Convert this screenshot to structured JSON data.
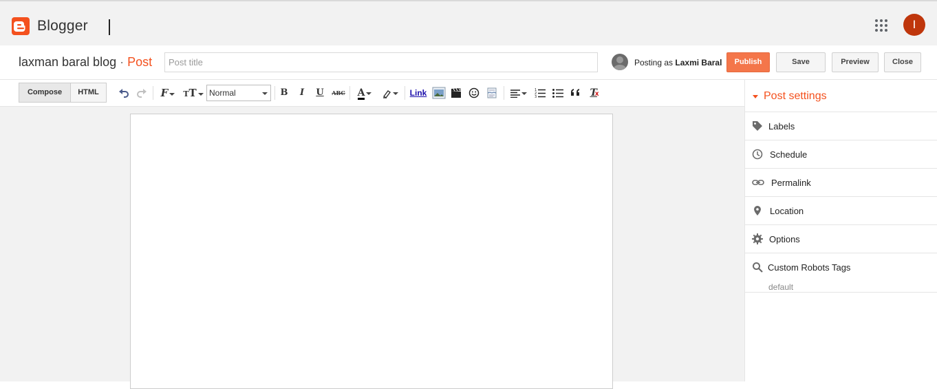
{
  "app": {
    "brand": "Blogger",
    "avatar_letter": "I",
    "brand_color": "#f4511e",
    "avatar_color": "#bf360c"
  },
  "titlebar": {
    "blog_name": "laxman baral blog",
    "separator": "·",
    "post_label": "Post",
    "title_placeholder": "Post title",
    "title_value": "",
    "posting_as_prefix": "Posting as",
    "posting_as_name": "Laxmi Baral",
    "buttons": {
      "publish": "Publish",
      "save": "Save",
      "preview": "Preview",
      "close": "Close"
    }
  },
  "toolbar": {
    "compose": "Compose",
    "html": "HTML",
    "font_size_select": "Normal",
    "bold": "B",
    "italic": "I",
    "underline": "U",
    "strike": "ABC",
    "link": "Link",
    "icons": [
      "undo-icon",
      "redo-icon",
      "font-family-icon",
      "font-size-icon",
      "text-color-icon",
      "highlight-icon",
      "image-icon",
      "video-icon",
      "emoji-icon",
      "jump-break-icon",
      "align-icon",
      "numbered-list-icon",
      "bulleted-list-icon",
      "quote-icon",
      "clear-formatting-icon"
    ]
  },
  "sidebar": {
    "title": "Post settings",
    "items": [
      {
        "label": "Labels",
        "icon": "tag-icon"
      },
      {
        "label": "Schedule",
        "icon": "clock-icon"
      },
      {
        "label": "Permalink",
        "icon": "link-icon"
      },
      {
        "label": "Location",
        "icon": "pin-icon"
      },
      {
        "label": "Options",
        "icon": "gear-icon"
      },
      {
        "label": "Custom Robots Tags",
        "icon": "search-icon",
        "value": "default"
      }
    ]
  }
}
